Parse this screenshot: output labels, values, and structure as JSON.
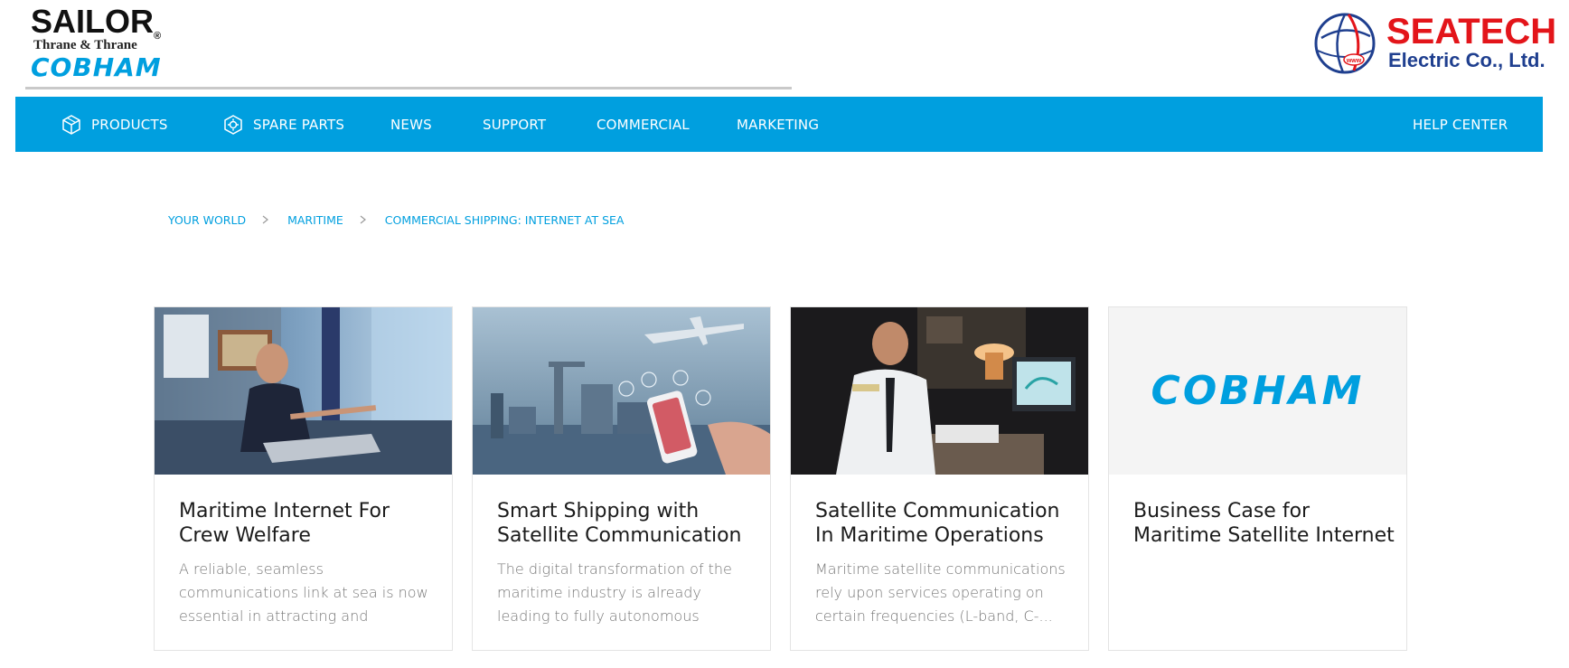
{
  "brand_left": {
    "sailor": "SAILOR",
    "registered": "®",
    "thrane": "Thrane & Thrane",
    "cobham": "COBHAM"
  },
  "brand_right": {
    "title": "SEATECH",
    "subtitle": "Electric Co., Ltd.",
    "globe_text": "www"
  },
  "colors": {
    "accent": "#009fdf",
    "seatech_red": "#e3151a",
    "seatech_blue": "#1f3f8f"
  },
  "nav": {
    "products": "PRODUCTS",
    "spare_parts": "SPARE PARTS",
    "news": "NEWS",
    "support": "SUPPORT",
    "commercial": "COMMERCIAL",
    "marketing": "MARKETING",
    "help_center": "HELP CENTER",
    "products_icon": "box-icon",
    "spare_parts_icon": "gear-box-icon"
  },
  "breadcrumb": {
    "items": [
      "YOUR WORLD",
      "MARITIME",
      "COMMERCIAL SHIPPING: INTERNET AT SEA"
    ],
    "separator_icon": "chevron-right-icon"
  },
  "cards": [
    {
      "image": "crew-member-laptop-photo",
      "title": "Maritime Internet For Crew Welfare",
      "description": "A reliable, seamless communications link at sea is now essential in attracting and retainin..."
    },
    {
      "image": "smart-shipping-port-phone-photo",
      "title": "Smart Shipping with Satellite Communication",
      "description": "The digital transformation of the maritime industry is already leading to fully autonomous shipping:..."
    },
    {
      "image": "officer-at-monitor-photo",
      "title": "Satellite Communication In Maritime Operations",
      "description": "Maritime satellite communications rely upon services operating on certain frequencies (L-band, C-..."
    },
    {
      "image": "cobham-logo",
      "image_text": "COBHAM",
      "title": "Business Case for Maritime Satellite Internet",
      "description": ""
    }
  ]
}
